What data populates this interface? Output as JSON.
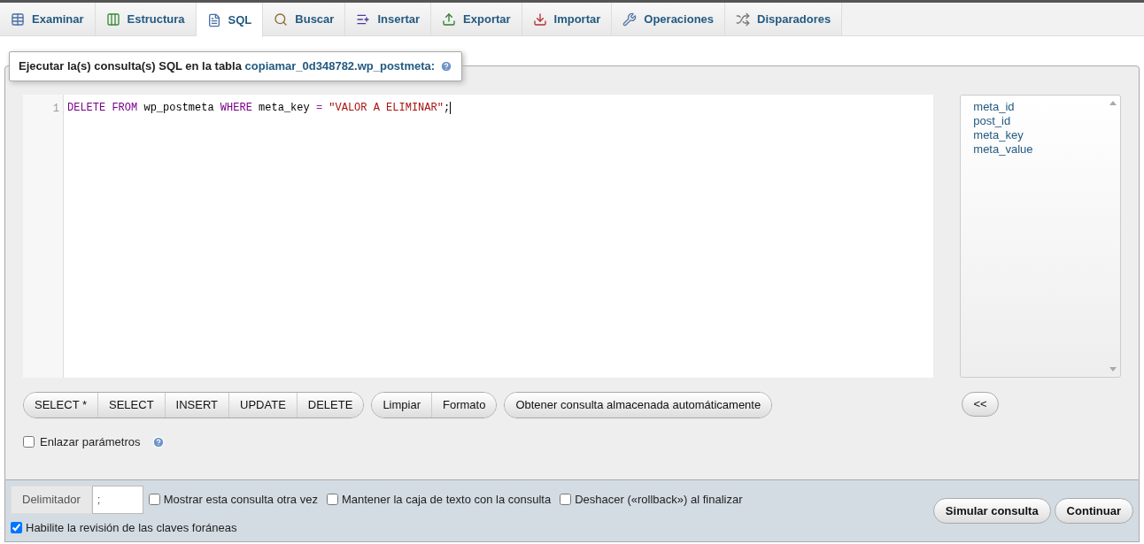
{
  "tabs": [
    {
      "label": "Examinar",
      "selected": false
    },
    {
      "label": "Estructura",
      "selected": false
    },
    {
      "label": "SQL",
      "selected": true
    },
    {
      "label": "Buscar",
      "selected": false
    },
    {
      "label": "Insertar",
      "selected": false
    },
    {
      "label": "Exportar",
      "selected": false
    },
    {
      "label": "Importar",
      "selected": false
    },
    {
      "label": "Operaciones",
      "selected": false
    },
    {
      "label": "Disparadores",
      "selected": false
    }
  ],
  "legend": {
    "text": "Ejecutar la(s) consulta(s) SQL en la tabla",
    "table": "copiamar_0d348782.wp_postmeta:"
  },
  "editor": {
    "lines": [
      {
        "number": "1",
        "tokens": [
          {
            "kind": "keyword",
            "text": "DELETE"
          },
          {
            "kind": "keyword",
            "text": "FROM"
          },
          {
            "kind": "name",
            "text": "wp_postmeta"
          },
          {
            "kind": "keyword",
            "text": "WHERE"
          },
          {
            "kind": "name",
            "text": "meta_key"
          },
          {
            "kind": "operator",
            "text": "="
          },
          {
            "kind": "string",
            "text": "\"VALOR A ELIMINAR\""
          },
          {
            "kind": "punctuation",
            "text": ";"
          }
        ]
      }
    ]
  },
  "columns": [
    "meta_id",
    "post_id",
    "meta_key",
    "meta_value"
  ],
  "button_groups": [
    [
      "SELECT *",
      "SELECT",
      "INSERT",
      "UPDATE",
      "DELETE"
    ],
    [
      "Limpiar",
      "Formato"
    ],
    [
      "Obtener consulta almacenada automáticamente"
    ]
  ],
  "insert_button": "<<",
  "bind_params": {
    "label": "Enlazar parámetros",
    "checked": false
  },
  "footer": {
    "delimiter_label": "Delimitador",
    "delimiter_value": ";",
    "options": [
      {
        "label": "Mostrar esta consulta otra vez",
        "checked": false
      },
      {
        "label": "Mantener la caja de texto con la consulta",
        "checked": false
      },
      {
        "label": "Deshacer («rollback») al finalizar",
        "checked": false
      }
    ],
    "foreign_keys": {
      "label": "Habilite la revisión de las claves foráneas",
      "checked": true
    },
    "buttons": [
      "Simular consulta",
      "Continuar"
    ]
  }
}
